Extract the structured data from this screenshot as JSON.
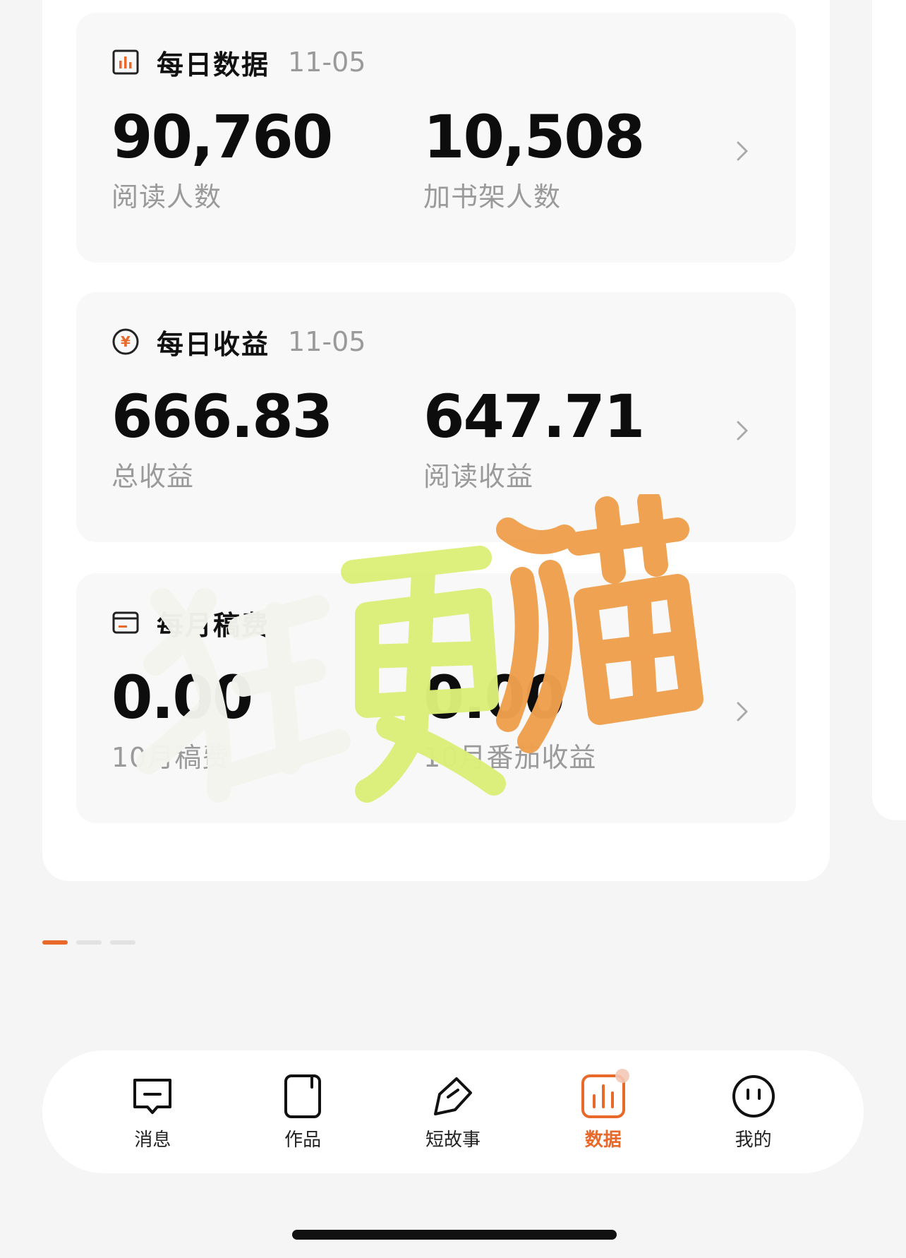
{
  "cards": [
    {
      "icon": "bar-chart-icon",
      "title": "每日数据",
      "date": "11-05",
      "left": {
        "value": "90,760",
        "label": "阅读人数"
      },
      "right": {
        "value": "10,508",
        "label": "加书架人数"
      }
    },
    {
      "icon": "yen-coin-icon",
      "title": "每日收益",
      "date": "11-05",
      "left": {
        "value": "666.83",
        "label": "总收益"
      },
      "right": {
        "value": "647.71",
        "label": "阅读收益"
      }
    },
    {
      "icon": "wallet-icon",
      "title": "每月稿费",
      "date": "",
      "left": {
        "value": "0.00",
        "label": "10月稿费"
      },
      "right": {
        "value": "0.00",
        "label": "10月番茄收益"
      }
    }
  ],
  "watermark": {
    "text": "狂更猫",
    "colors": [
      "#f4f4ee",
      "#dcef78",
      "#f0a04e"
    ]
  },
  "pagination": {
    "count": 3,
    "active_index": 0
  },
  "tabs": [
    {
      "label": "消息",
      "icon": "message-icon",
      "active": false
    },
    {
      "label": "作品",
      "icon": "book-icon",
      "active": false
    },
    {
      "label": "短故事",
      "icon": "pen-nib-icon",
      "active": false
    },
    {
      "label": "数据",
      "icon": "data-chart-icon",
      "active": true,
      "badge": true
    },
    {
      "label": "我的",
      "icon": "face-icon",
      "active": false
    }
  ],
  "colors": {
    "accent": "#e8692a",
    "muted_text": "#9a9a9a",
    "card_bg": "#f8f8f8"
  }
}
